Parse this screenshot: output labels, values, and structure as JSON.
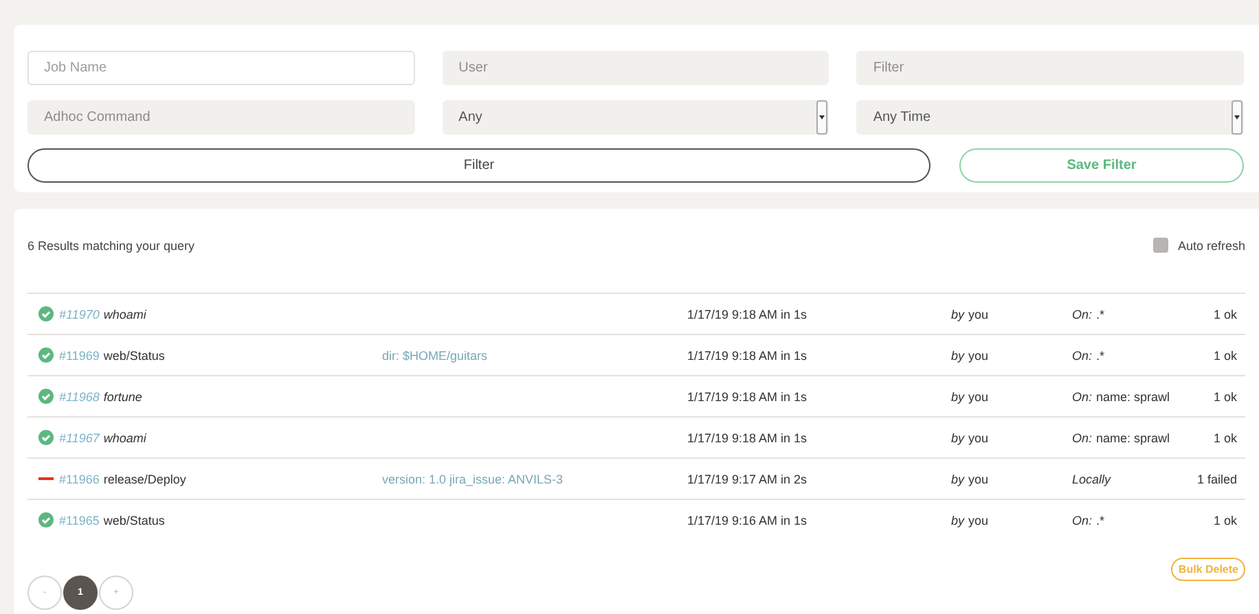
{
  "filters": {
    "fields": [
      {
        "kind": "text",
        "placeholder": "Job Name",
        "disabled": false
      },
      {
        "kind": "text",
        "placeholder": "User",
        "disabled": true
      },
      {
        "kind": "text",
        "placeholder": "Filter",
        "disabled": true
      },
      {
        "kind": "text",
        "placeholder": "Adhoc Command",
        "disabled": true
      },
      {
        "kind": "select",
        "value": "Any"
      },
      {
        "kind": "select",
        "value": "Any Time"
      }
    ],
    "filter_button": "Filter",
    "save_button": "Save Filter"
  },
  "results": {
    "summary": "6 Results matching your query",
    "auto_refresh": {
      "label": "Auto refresh",
      "checked": false
    },
    "rows": [
      {
        "failed": false,
        "id": "#11970",
        "name": "whoami",
        "kind": "adhoc",
        "time": "1/17/19 9:18 AM in 1s",
        "by": "by",
        "user": "you",
        "node_label": "On:",
        "node": ".*",
        "result": "1 ok"
      },
      {
        "failed": false,
        "id": "#11969",
        "name": "web/Status",
        "kind": "job",
        "args": "dir: $HOME/guitars",
        "time": "1/17/19 9:18 AM in 1s",
        "by": "by",
        "user": "you",
        "node_label": "On:",
        "node": ".*",
        "result": "1 ok"
      },
      {
        "failed": false,
        "id": "#11968",
        "name": "fortune",
        "kind": "adhoc",
        "time": "1/17/19 9:18 AM in 1s",
        "by": "by",
        "user": "you",
        "node_label": "On:",
        "node": "name: sprawl",
        "result": "1 ok"
      },
      {
        "failed": false,
        "id": "#11967",
        "name": "whoami",
        "kind": "adhoc",
        "time": "1/17/19 9:18 AM in 1s",
        "by": "by",
        "user": "you",
        "node_label": "On:",
        "node": "name: sprawl",
        "result": "1 ok"
      },
      {
        "failed": true,
        "id": "#11966",
        "name": "release/Deploy",
        "kind": "job",
        "args": "version: 1.0 jira_issue: ANVILS-3",
        "time": "1/17/19 9:17 AM in 2s",
        "by": "by",
        "user": "you",
        "node_label": "Locally",
        "result": "1 failed"
      },
      {
        "failed": false,
        "id": "#11965",
        "name": "web/Status",
        "kind": "job",
        "time": "1/17/19 9:16 AM in 1s",
        "by": "by",
        "user": "you",
        "node_label": "On:",
        "node": ".*",
        "result": "1 ok"
      }
    ],
    "bulk_delete": "Bulk Delete",
    "pagination": [
      {
        "label": "-",
        "selected": false
      },
      {
        "label": "1",
        "selected": true
      },
      {
        "label": "+",
        "selected": false
      }
    ]
  }
}
